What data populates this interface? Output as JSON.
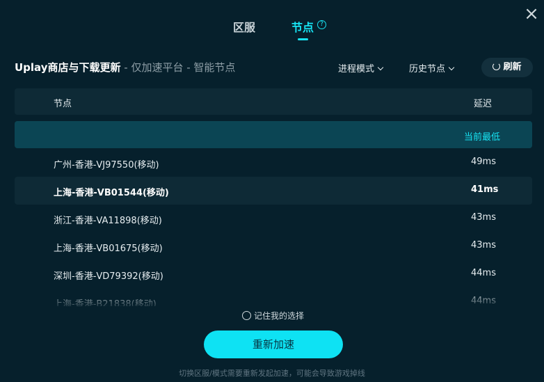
{
  "window": {
    "close_icon": "×"
  },
  "tabs": [
    {
      "label": "区服",
      "active": false
    },
    {
      "label": "节点",
      "active": true,
      "help_icon": "?"
    }
  ],
  "title": {
    "main": "Uplay商店与下载更新",
    "sub": " - 仅加速平台 - 智能节点"
  },
  "controls": {
    "mode_label": "进程模式",
    "history_label": "历史节点",
    "refresh_label": "刷新"
  },
  "table": {
    "columns": {
      "node": "节点",
      "latency": "延迟"
    },
    "best_label": "当前最低",
    "rows": [
      {
        "name": "广州-香港-VJ97550(移动)",
        "latency": "49ms"
      },
      {
        "name": "上海-香港-VB01544(移动)",
        "latency": "41ms"
      },
      {
        "name": "浙江-香港-VA11898(移动)",
        "latency": "43ms"
      },
      {
        "name": "上海-香港-VB01675(移动)",
        "latency": "43ms"
      },
      {
        "name": "深圳-香港-VD79392(移动)",
        "latency": "44ms"
      },
      {
        "name": "上海-香港-B21838(移动)",
        "latency": "44ms"
      }
    ]
  },
  "remember_label": "记住我的选择",
  "accelerate_label": "重新加速",
  "footer_note": "切换区服/模式需要重新发起加速，可能会导致游戏掉线",
  "colors": {
    "accent": "#17e3f3",
    "background": "#06202c",
    "button": "#0ee2f3"
  }
}
